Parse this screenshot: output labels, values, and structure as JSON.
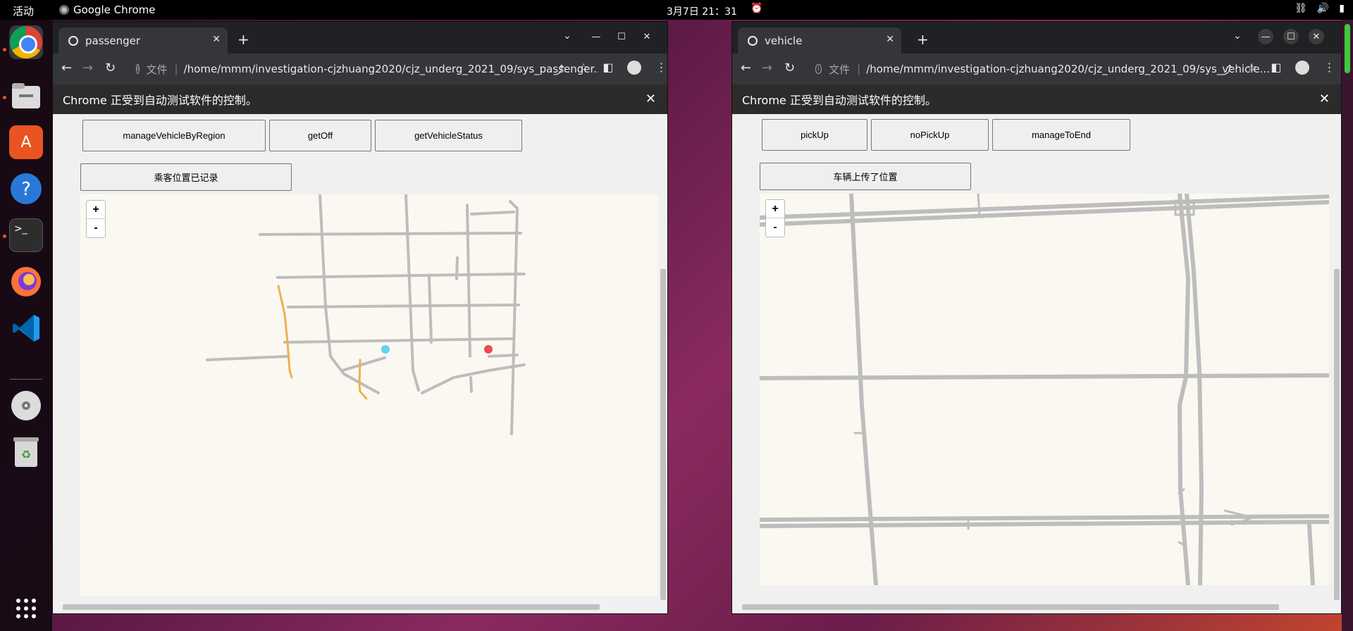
{
  "topbar": {
    "activities": "活动",
    "app_name": "Google Chrome",
    "clock": "3月7日  21：31"
  },
  "dock": {
    "icons": [
      "chrome-icon",
      "files-icon",
      "software-icon",
      "help-icon",
      "terminal-icon",
      "firefox-icon",
      "vscode-icon",
      "disc-icon",
      "trash-icon",
      "apps-grid-icon"
    ]
  },
  "windows": {
    "passenger": {
      "tab_title": "passenger",
      "url_prefix": "文件",
      "url": "/home/mmm/investigation-cjzhuang2020/cjz_underg_2021_09/sys_passenger...",
      "infobar": "Chrome 正受到自动测试软件的控制。",
      "buttons": [
        "manageVehicleByRegion",
        "getOff",
        "getVehicleStatus"
      ],
      "status_button": "乘客位置已记录",
      "zoom_in": "+",
      "zoom_out": "-",
      "markers": {
        "passenger_color": "#5fd3f0",
        "vehicle_color": "#e84c4c"
      }
    },
    "vehicle": {
      "tab_title": "vehicle",
      "url_prefix": "文件",
      "url": "/home/mmm/investigation-cjzhuang2020/cjz_underg_2021_09/sys_vehicle...",
      "infobar": "Chrome 正受到自动测试软件的控制。",
      "buttons": [
        "pickUp",
        "noPickUp",
        "manageToEnd"
      ],
      "status_button": "车辆上传了位置",
      "zoom_in": "+",
      "zoom_out": "-"
    }
  },
  "colors": {
    "road": "#bdbdbd",
    "route": "#f0b050",
    "map_bg": "#faf8f1"
  }
}
